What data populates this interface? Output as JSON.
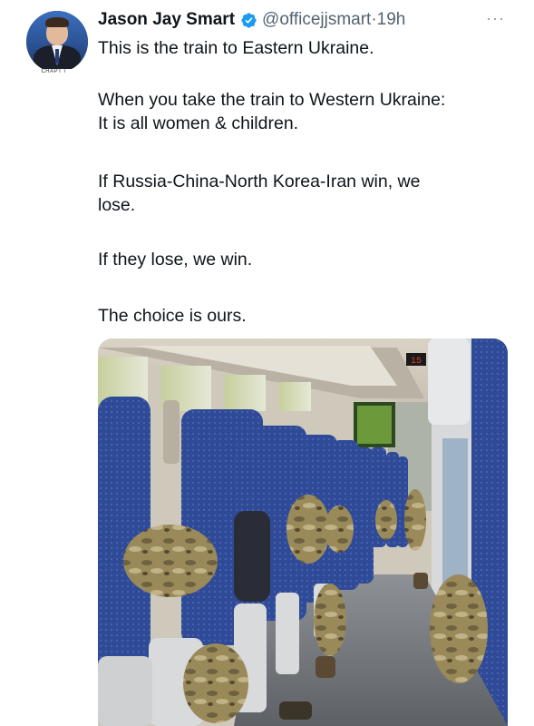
{
  "tweet": {
    "author_name": "Jason Jay Smart",
    "handle": "@officejjsmart",
    "separator": "·",
    "time": "19h",
    "more_label": "···",
    "avatar_caption": "CHAPT I",
    "lines": [
      "This is the train to Eastern Ukraine.",
      "When you take the train to Western Ukraine:",
      "It is all women & children.",
      "If Russia-China-North Korea-Iran win, we",
      "lose.",
      "If they lose, we win.",
      "The choice is ours."
    ]
  },
  "photo": {
    "screen_number": "15",
    "colors": {
      "seat": "#2f4a96",
      "seat_dark": "#1e3474",
      "floor": "#7b7f84",
      "ceiling": "#e8e3d8",
      "camo": "#9a8a5a"
    }
  },
  "colors": {
    "verified_blue": "#1d9bf0",
    "secondary_text": "#536471"
  }
}
